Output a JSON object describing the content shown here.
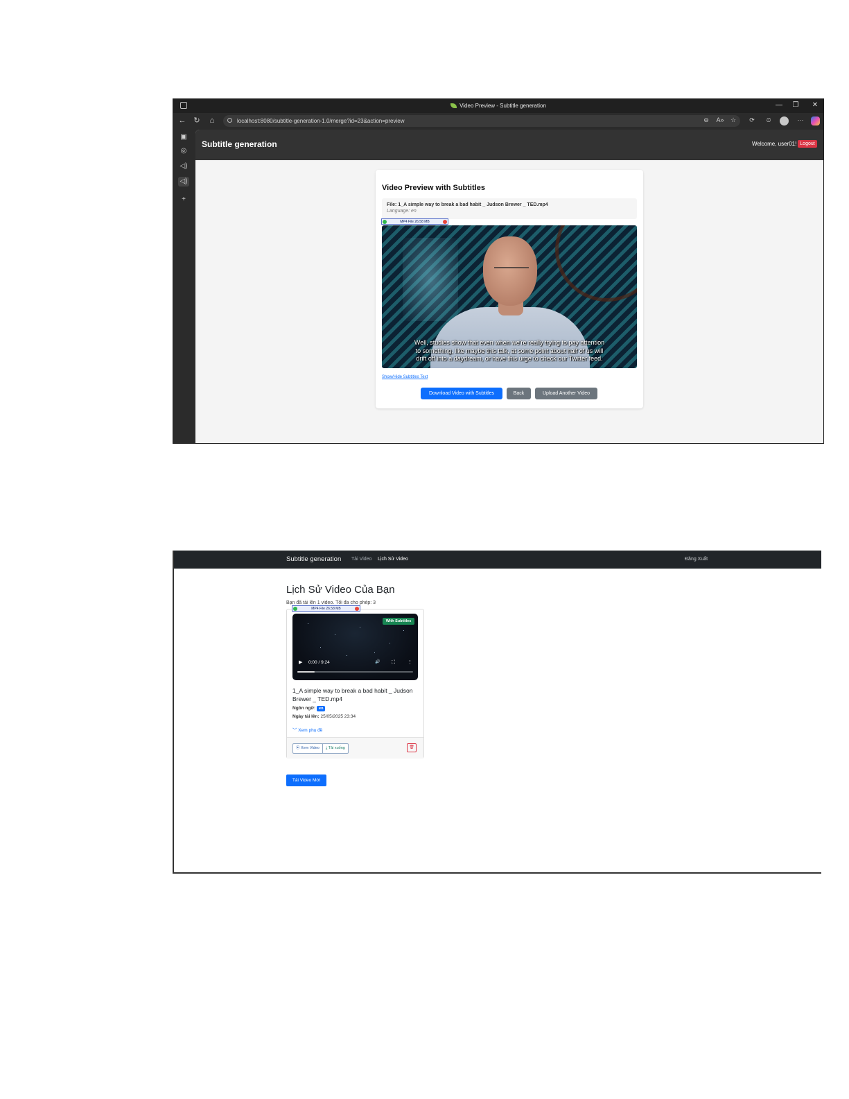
{
  "preview_window": {
    "window_title": "Video Preview - Subtitle generation",
    "url": "localhost:8080/subtitle-generation-1.0/merge?id=23&action=preview",
    "controls": {
      "minimize": "—",
      "maximize": "❐",
      "close": "✕",
      "back": "←",
      "refresh": "↻",
      "home": "⌂"
    },
    "toolbar_icons": [
      "zoom-icon",
      "read-aloud-icon",
      "favorite-icon",
      "extensions-icon",
      "history-icon",
      "profile-icon",
      "more-icon",
      "copilot-icon"
    ],
    "toolbar_glyphs": {
      "zoom": "⊖",
      "read_aloud": "A»",
      "favorite": "☆",
      "extensions": "⟳",
      "history": "⏲",
      "more": "···"
    },
    "sidebar_glyphs": {
      "panel": "▣",
      "github": "◎",
      "audio1": "◁)",
      "audio2": "◁)",
      "add": "+"
    },
    "app": {
      "brand": "Subtitle generation",
      "welcome": "Welcome, user01!",
      "logout": "Logout"
    },
    "card": {
      "heading": "Video Preview with Subtitles",
      "file_label": "File: 1_A simple way to break a bad habit _ Judson Brewer _ TED.mp4",
      "language_label": "Language: en",
      "file_badge": "MP4 File 26.58 MB",
      "subtitle_lines": [
        "Well, studies show that even when we're really trying to pay attention",
        "to something, like maybe this talk, at some point about half of us will",
        "drift off into a daydream, or have this urge to check our Twitter feed."
      ],
      "toggle_link": "Show/Hide Subtitles Text",
      "buttons": {
        "download": "Download Video with Subtitles",
        "back": "Back",
        "upload": "Upload Another Video"
      }
    }
  },
  "history_page": {
    "nav": {
      "brand": "Subtitle generation",
      "upload_link": "Tải Video",
      "history_link": "Lịch Sử Video",
      "logout": "Đăng Xuất"
    },
    "title": "Lịch Sử Video Của Bạn",
    "quota_text": "Bạn đã tải lên 1 video. Tối đa cho phép: 3",
    "video_card": {
      "file_badge": "MP4 File 26.58 MB",
      "status_badge": "With Subtitles",
      "player": {
        "time": "0:00 / 9:24",
        "play": "▶",
        "volume": "🔊",
        "fullscreen": "⛶",
        "menu": "⋮",
        "progress_fraction": 0.15
      },
      "video_title": "1_A simple way to break a bad habit _ Judson Brewer _ TED.mp4",
      "language_label": "Ngôn ngữ:",
      "language_value": "en",
      "date_label": "Ngày tải lên:",
      "date_value": "25/05/2025 23:34",
      "subtitles_toggle": "﹀ Xem phụ đề",
      "watch_button": "⦿ Xem Video",
      "download_button": "⤓ Tải xuống",
      "delete_glyph": "🗑"
    },
    "new_upload_button": "Tải Video Mới"
  },
  "colors": {
    "primary": "#0d6efd",
    "danger": "#dc3545",
    "secondary": "#6c757d",
    "success": "#198754",
    "navbar_dark": "#212529"
  }
}
